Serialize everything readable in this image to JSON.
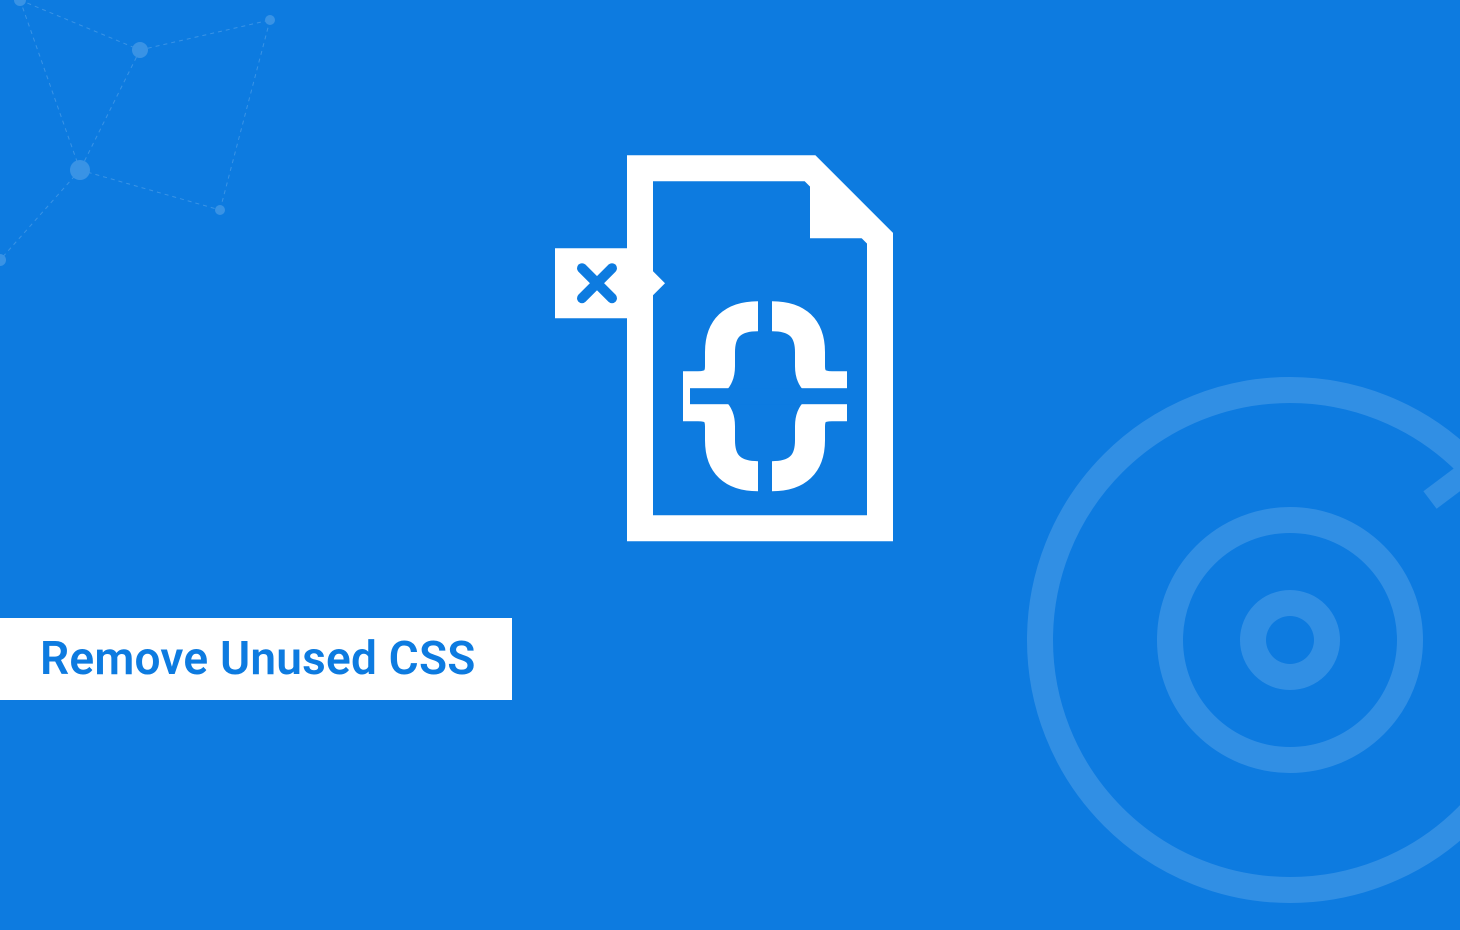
{
  "title": "Remove Unused CSS",
  "colors": {
    "background": "#0d7be0",
    "foreground": "#ffffff"
  },
  "icon": {
    "name": "css-file-delete-icon",
    "tag_mark": "x",
    "glyph": "curly-braces"
  }
}
